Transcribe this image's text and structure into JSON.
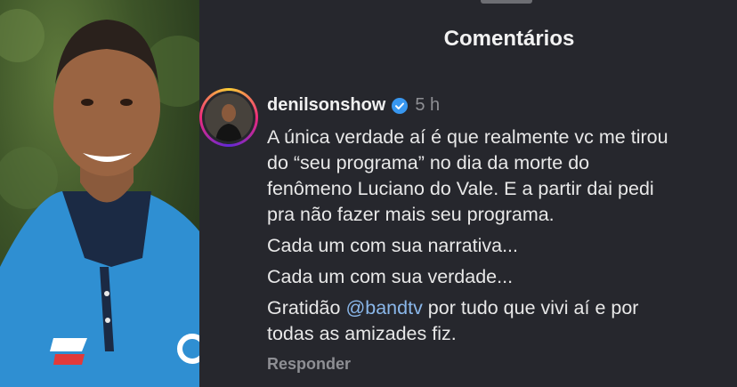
{
  "header": {
    "title": "Comentários"
  },
  "comment": {
    "username": "denilsonshow",
    "time": "5 h",
    "lines": [
      "A única verdade aí é que realmente vc me tirou",
      "do “seu programa” no dia da morte do",
      "fenômeno Luciano do Vale. E a partir dai pedi",
      "pra não fazer mais seu programa."
    ],
    "line2": "Cada um com sua narrativa...",
    "line3": "Cada um com sua verdade...",
    "gratitude_prefix": "Gratidão ",
    "mention": "@bandtv",
    "gratitude_suffix": " por tudo que vivi aí e por",
    "gratitude_line2": "todas as amizades fiz.",
    "reply_label": "Responder"
  },
  "colors": {
    "mention": "#8ab7ea",
    "verified": "#3897f0",
    "panel_bg": "#26272d"
  },
  "icons": {
    "verified": "verified-badge-icon"
  }
}
